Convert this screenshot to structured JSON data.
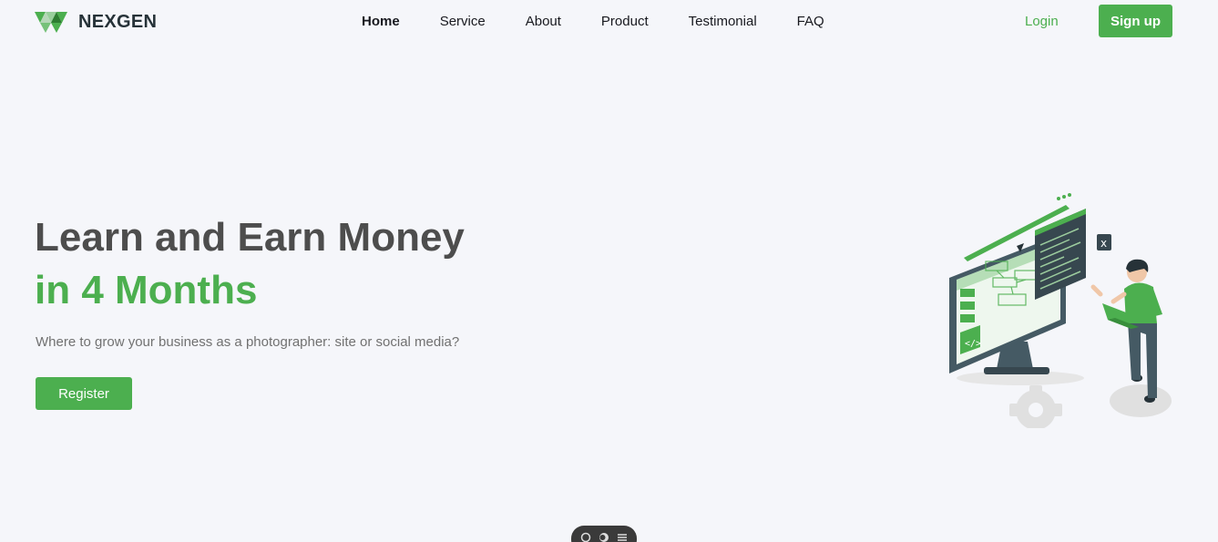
{
  "brand": {
    "name": "NEXGEN",
    "accent_color": "#4caf4f",
    "logo_icon": "triangle-logo-icon"
  },
  "nav": {
    "items": [
      {
        "label": "Home",
        "active": true
      },
      {
        "label": "Service",
        "active": false
      },
      {
        "label": "About",
        "active": false
      },
      {
        "label": "Product",
        "active": false
      },
      {
        "label": "Testimonial",
        "active": false
      },
      {
        "label": "FAQ",
        "active": false
      }
    ]
  },
  "auth": {
    "login_label": "Login",
    "signup_label": "Sign up"
  },
  "hero": {
    "title_line1": "Learn and Earn Money",
    "title_line2": "in 4 Months",
    "subtitle": "Where to grow your business as a photographer: site or social media?",
    "cta_label": "Register",
    "illustration": "developer-monitor-illustration"
  },
  "toolbar": {
    "icons": [
      "chat-icon",
      "toggle-icon",
      "menu-icon"
    ]
  }
}
